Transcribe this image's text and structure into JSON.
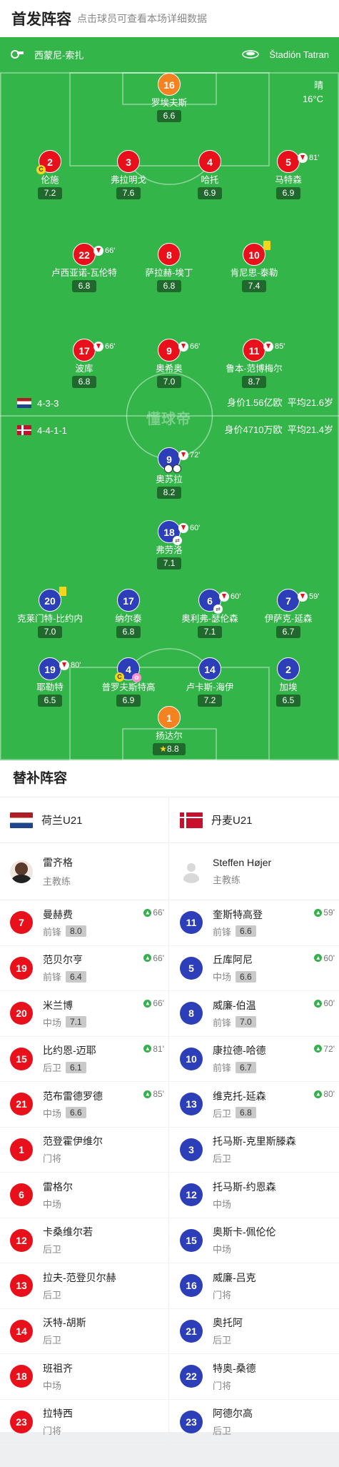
{
  "header": {
    "title": "首发阵容",
    "subtitle": "点击球员可查看本场详细数据"
  },
  "venue": {
    "city": "西蒙尼-索扎",
    "stadium": "Štadión Tatran"
  },
  "weather": {
    "condition": "晴",
    "temp": "16°C"
  },
  "watermark": "懂球帝",
  "home": {
    "formation": "4-3-3",
    "value": "身价1.56亿欧",
    "avg_age": "平均21.6岁"
  },
  "away": {
    "formation": "4-4-1-1",
    "value": "身价4710万欧",
    "avg_age": "平均21.4岁"
  },
  "home_players": [
    {
      "num": "16",
      "name": "罗埃夫斯",
      "rating": "6.6"
    },
    {
      "num": "2",
      "name": "伦施",
      "rating": "7.2"
    },
    {
      "num": "3",
      "name": "弗拉明戈",
      "rating": "7.6"
    },
    {
      "num": "4",
      "name": "哈托",
      "rating": "6.9"
    },
    {
      "num": "5",
      "name": "马特森",
      "rating": "6.9",
      "sub": "81'"
    },
    {
      "num": "22",
      "name": "卢西亚诺-瓦伦特",
      "rating": "6.8",
      "sub": "66'"
    },
    {
      "num": "8",
      "name": "萨拉赫-埃丁",
      "rating": "6.8"
    },
    {
      "num": "10",
      "name": "肯尼思-泰勒",
      "rating": "7.4"
    },
    {
      "num": "17",
      "name": "波库",
      "rating": "6.8",
      "sub": "66'"
    },
    {
      "num": "9",
      "name": "奥希奥",
      "rating": "7.0",
      "sub": "66'"
    },
    {
      "num": "11",
      "name": "鲁本-范博梅尔",
      "rating": "8.7",
      "sub": "85'"
    }
  ],
  "away_players": [
    {
      "num": "9",
      "name": "奥苏拉",
      "rating": "8.2",
      "sub": "72'"
    },
    {
      "num": "18",
      "name": "弗劳洛",
      "rating": "7.1",
      "sub": "60'"
    },
    {
      "num": "20",
      "name": "克莱门特-比约内",
      "rating": "7.0"
    },
    {
      "num": "17",
      "name": "纳尔泰",
      "rating": "6.8"
    },
    {
      "num": "6",
      "name": "奥利弗-瑟伦森",
      "rating": "7.1",
      "sub": "60'"
    },
    {
      "num": "7",
      "name": "伊萨克-延森",
      "rating": "6.7",
      "sub": "59'"
    },
    {
      "num": "19",
      "name": "耶勒特",
      "rating": "6.5",
      "sub": "80'"
    },
    {
      "num": "4",
      "name": "普罗夫斯特高",
      "rating": "6.9"
    },
    {
      "num": "14",
      "name": "卢卡斯-海伊",
      "rating": "7.2"
    },
    {
      "num": "2",
      "name": "加埃",
      "rating": "6.5"
    },
    {
      "num": "1",
      "name": "扬达尔",
      "rating": "8.8"
    }
  ],
  "subs": {
    "title": "替补阵容",
    "home": {
      "team": "荷兰U21",
      "coach": "雷齐格",
      "coach_role": "主教练",
      "players": [
        {
          "num": "7",
          "name": "曼赫费",
          "pos": "前锋",
          "rating": "8.0",
          "time": "66'"
        },
        {
          "num": "19",
          "name": "范贝尔亨",
          "pos": "前锋",
          "rating": "6.4",
          "time": "66'"
        },
        {
          "num": "20",
          "name": "米兰博",
          "pos": "中场",
          "rating": "7.1",
          "time": "66'"
        },
        {
          "num": "15",
          "name": "比约恩-迈耶",
          "pos": "后卫",
          "rating": "6.1",
          "time": "81'"
        },
        {
          "num": "21",
          "name": "范布雷德罗德",
          "pos": "中场",
          "rating": "6.6",
          "time": "85'"
        },
        {
          "num": "1",
          "name": "范登霍伊维尔",
          "pos": "门将"
        },
        {
          "num": "6",
          "name": "雷格尔",
          "pos": "中场"
        },
        {
          "num": "12",
          "name": "卡桑维尔若",
          "pos": "后卫"
        },
        {
          "num": "13",
          "name": "拉夫-范登贝尔赫",
          "pos": "后卫"
        },
        {
          "num": "14",
          "name": "沃特-胡斯",
          "pos": "后卫"
        },
        {
          "num": "18",
          "name": "班祖齐",
          "pos": "中场"
        },
        {
          "num": "23",
          "name": "拉特西",
          "pos": "门将"
        }
      ]
    },
    "away": {
      "team": "丹麦U21",
      "coach": "Steffen Højer",
      "coach_role": "主教练",
      "players": [
        {
          "num": "11",
          "name": "奎斯特高登",
          "pos": "前锋",
          "rating": "6.6",
          "time": "59'"
        },
        {
          "num": "5",
          "name": "丘库阿尼",
          "pos": "中场",
          "rating": "6.6",
          "time": "60'"
        },
        {
          "num": "8",
          "name": "威廉-伯温",
          "pos": "前锋",
          "rating": "7.0",
          "time": "60'"
        },
        {
          "num": "10",
          "name": "康拉德-哈德",
          "pos": "前锋",
          "rating": "6.7",
          "time": "72'"
        },
        {
          "num": "13",
          "name": "维克托-延森",
          "pos": "后卫",
          "rating": "6.8",
          "time": "80'"
        },
        {
          "num": "3",
          "name": "托马斯-克里斯滕森",
          "pos": "后卫"
        },
        {
          "num": "12",
          "name": "托马斯-约恩森",
          "pos": "中场"
        },
        {
          "num": "15",
          "name": "奥斯卡-佩伦伦",
          "pos": "中场"
        },
        {
          "num": "16",
          "name": "威廉-吕克",
          "pos": "门将"
        },
        {
          "num": "21",
          "name": "奥托阿",
          "pos": "后卫"
        },
        {
          "num": "22",
          "name": "特奥-桑德",
          "pos": "门将"
        },
        {
          "num": "23",
          "name": "阿德尔高",
          "pos": "后卫"
        }
      ]
    }
  },
  "colors": {
    "pitch": "#34b54a",
    "home": "#e8101b",
    "away": "#2c3eb8",
    "keeper": "#f58220",
    "card": "#f7d51d"
  }
}
